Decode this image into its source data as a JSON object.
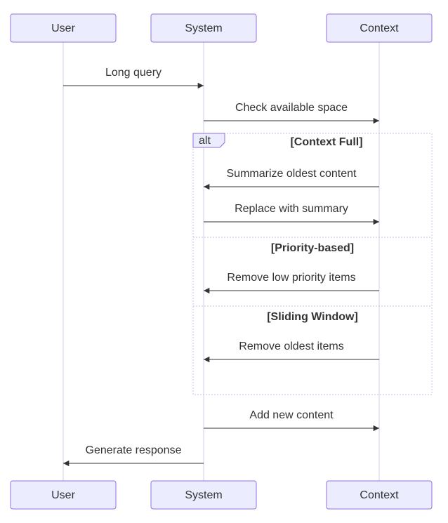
{
  "diagram": {
    "type": "sequence",
    "actors": [
      {
        "id": "user",
        "label": "User"
      },
      {
        "id": "system",
        "label": "System"
      },
      {
        "id": "context",
        "label": "Context"
      }
    ],
    "alt": {
      "keyword": "alt",
      "conditions": [
        "[Context Full]",
        "[Priority-based]",
        "[Sliding Window]"
      ]
    },
    "messages": {
      "m1": "Long query",
      "m2": "Check available space",
      "m3": "Summarize oldest content",
      "m4": "Replace with summary",
      "m5": "Remove low priority items",
      "m6": "Remove oldest items",
      "m7": "Add new content",
      "m8": "Generate response"
    }
  }
}
